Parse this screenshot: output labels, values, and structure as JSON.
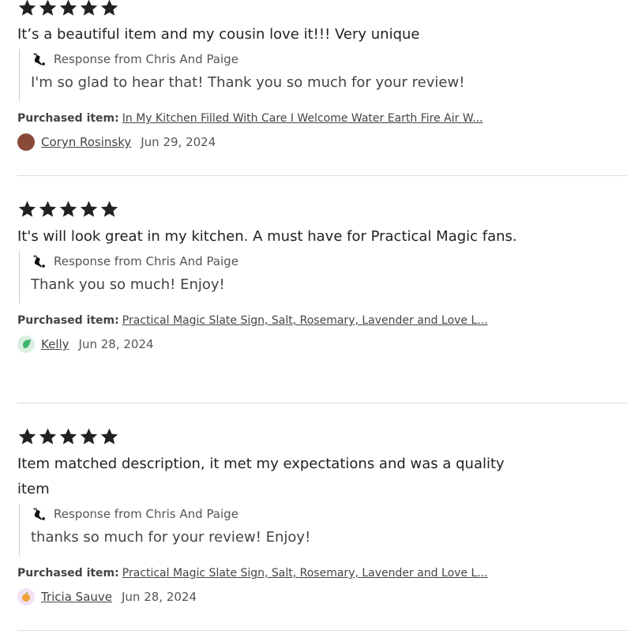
{
  "reviews": [
    {
      "rating": 5,
      "text": "It’s a beautiful item and my cousin love it!!! Very unique",
      "response_label": "Response from Chris And Paige",
      "response_text": "I'm so glad to hear that! Thank you so much for your review!",
      "purchased_label": "Purchased item:",
      "purchased_item": "In My Kitchen Filled With Care I Welcome Water Earth Fire Air W...",
      "reviewer": "Coryn Rosinsky",
      "date": "Jun 29, 2024",
      "avatar_color": "#8a4a3a"
    },
    {
      "rating": 5,
      "text": "It's will look great in my kitchen. A must have for Practical Magic fans.",
      "response_label": "Response from Chris And Paige",
      "response_text": "Thank you so much! Enjoy!",
      "purchased_label": "Purchased item:",
      "purchased_item": "Practical Magic Slate Sign, Salt, Rosemary, Lavender and Love L...",
      "reviewer": "Kelly",
      "date": "Jun 28, 2024",
      "avatar_color": "#3fb56b"
    },
    {
      "rating": 5,
      "text": "Item matched description, it met my expectations and was a quality item",
      "response_label": "Response from Chris And Paige",
      "response_text": "thanks so much for your review! Enjoy!",
      "purchased_label": "Purchased item:",
      "purchased_item": "Practical Magic Slate Sign, Salt, Rosemary, Lavender and Love L...",
      "reviewer": "Tricia Sauve",
      "date": "Jun 28, 2024",
      "avatar_color": "#f2a23a"
    }
  ],
  "colors": {
    "star": "#222222",
    "divider": "#dddddd"
  }
}
